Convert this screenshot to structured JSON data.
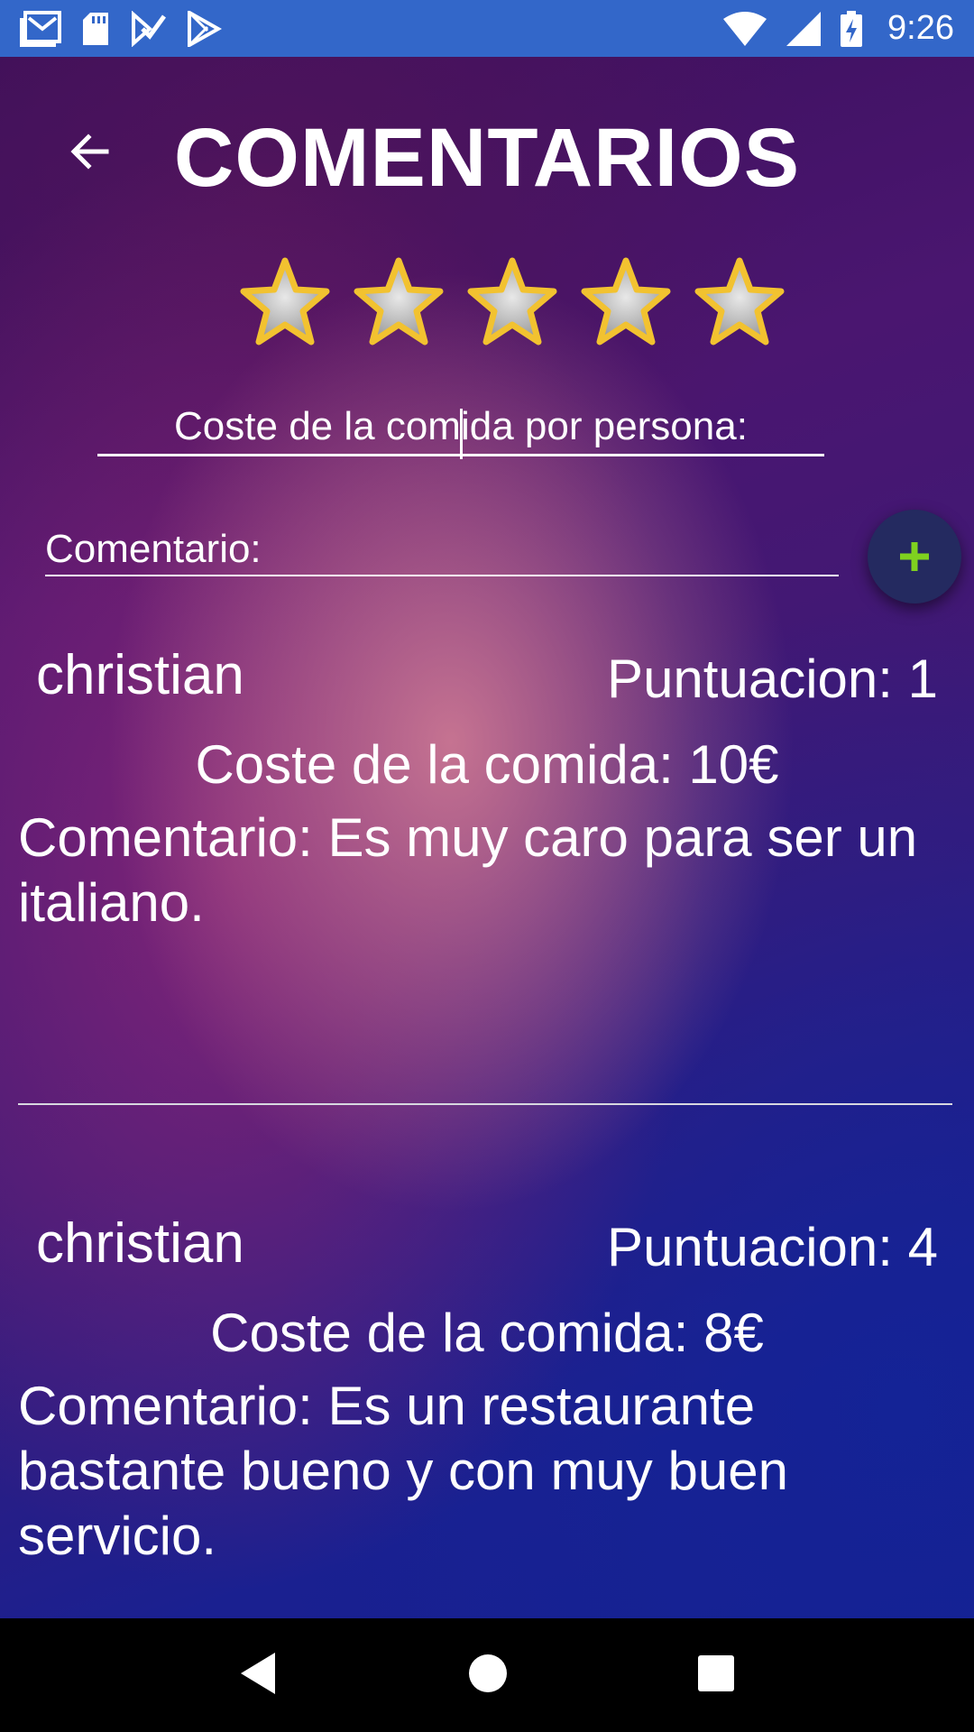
{
  "status_bar": {
    "time": "9:26",
    "icons_left": [
      "gmail-icon",
      "sd-card-icon",
      "task-check-icon",
      "play-store-icon"
    ],
    "icons_right": [
      "wifi-icon",
      "signal-icon",
      "battery-charging-icon"
    ],
    "background": "#3367c9"
  },
  "header": {
    "back_icon": "arrow-back-icon",
    "title": "COMENTARIOS"
  },
  "rating": {
    "max": 5,
    "star_icon": "star-icon",
    "star_color": "#f2c230"
  },
  "form": {
    "cost_placeholder": "Coste de la comida por persona:",
    "comment_placeholder": "Comentario:",
    "add_button_icon": "plus-icon",
    "add_button_color": "#7fd11f"
  },
  "comments": [
    {
      "user": "christian",
      "score": "Puntuacion: 1",
      "cost": "Coste de la comida: 10€",
      "text": "Comentario: Es muy caro para ser un italiano."
    },
    {
      "user": "christian",
      "score": "Puntuacion: 4",
      "cost": "Coste de la comida: 8€",
      "text": "Comentario: Es un restaurante bastante bueno y con muy buen servicio."
    }
  ],
  "nav_bar": {
    "icons": [
      "nav-back-icon",
      "nav-home-icon",
      "nav-recents-icon"
    ]
  }
}
